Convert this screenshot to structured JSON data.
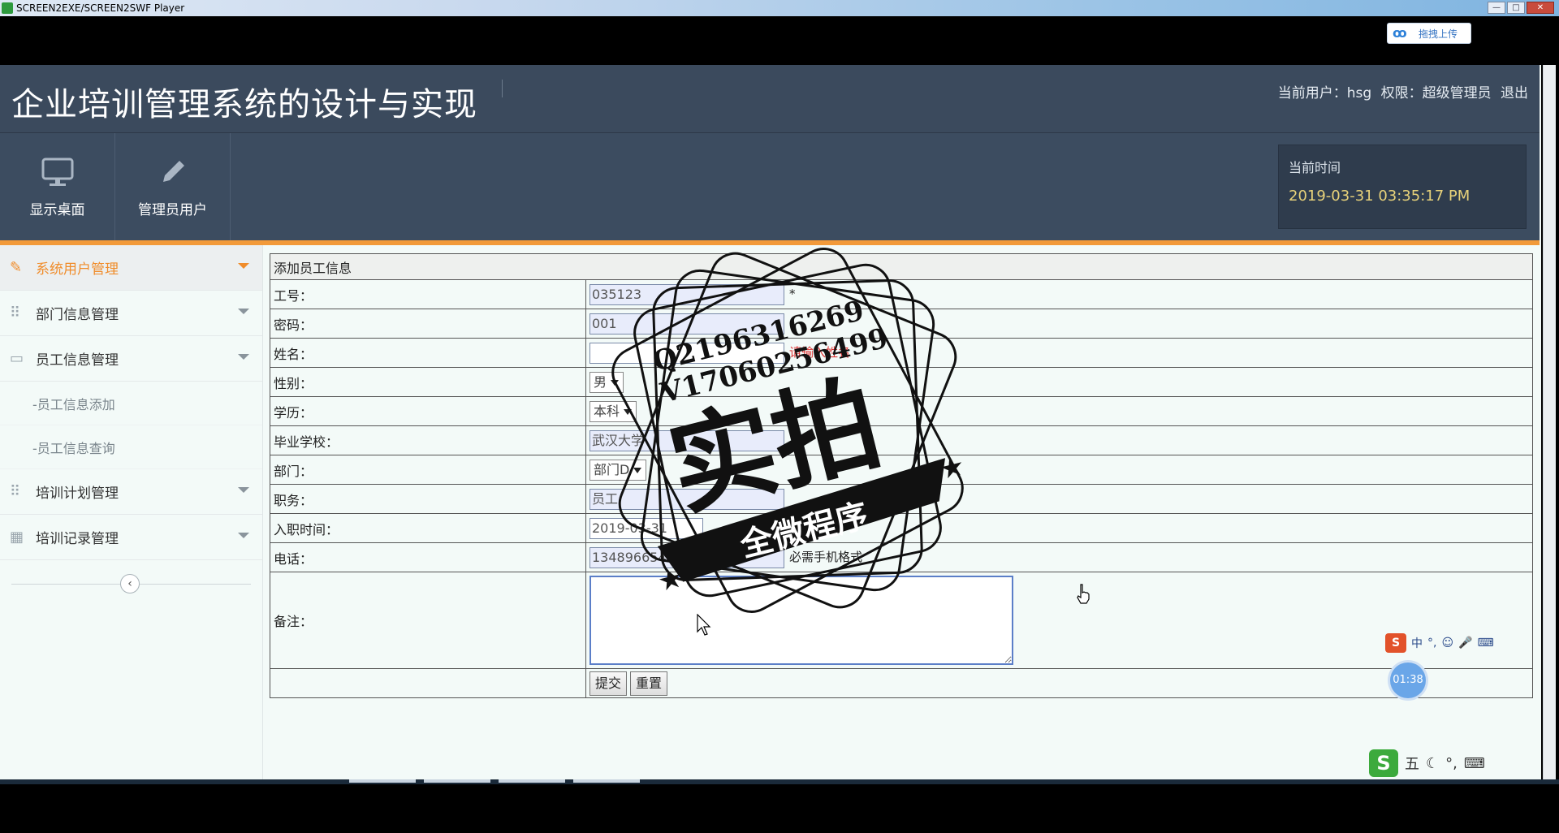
{
  "window": {
    "title": "SCREEN2EXE/SCREEN2SWF Player"
  },
  "upload_button": {
    "label": "拖拽上传"
  },
  "header": {
    "title": "企业培训管理系统的设计与实现",
    "user_label": "当前用户：hsg",
    "role_label": "权限：超级管理员",
    "logout": "退出"
  },
  "toolbar": {
    "buttons": [
      {
        "label": "显示桌面",
        "icon": "monitor-icon"
      },
      {
        "label": "管理员用户",
        "icon": "pencil-icon"
      }
    ],
    "time_label": "当前时间",
    "time_value": "2019-03-31 03:35:17 PM"
  },
  "sidebar": {
    "items": [
      {
        "label": "系统用户管理",
        "icon": "pencil-icon",
        "active": true
      },
      {
        "label": "部门信息管理",
        "icon": "grid-icon"
      },
      {
        "label": "员工信息管理",
        "icon": "monitor-icon"
      },
      {
        "label": "培训计划管理",
        "icon": "grid-icon"
      },
      {
        "label": "培训记录管理",
        "icon": "layout-icon"
      }
    ],
    "sub_items": [
      "-员工信息添加",
      "-员工信息查询"
    ]
  },
  "form": {
    "caption": "添加员工信息",
    "rows": {
      "emp_no": {
        "label": "工号：",
        "value": "035123",
        "mark": "*"
      },
      "password": {
        "label": "密码：",
        "value": "001"
      },
      "name": {
        "label": "姓名：",
        "value": "",
        "hint": "请输入姓名"
      },
      "gender": {
        "label": "性别：",
        "value": "男"
      },
      "education": {
        "label": "学历：",
        "value": "本科"
      },
      "school": {
        "label": "毕业学校：",
        "value": "武汉大学"
      },
      "dept": {
        "label": "部门：",
        "value": "部门D"
      },
      "position": {
        "label": "职务：",
        "value": "员工"
      },
      "join_date": {
        "label": "入职时间：",
        "value": "2019-03-31"
      },
      "phone": {
        "label": "电话：",
        "value": "13489665487",
        "hint": "必需手机格式"
      },
      "memo": {
        "label": "备注：",
        "value": ""
      }
    },
    "submit": "提交",
    "reset": "重置"
  },
  "watermark": {
    "line1": "Q2196316269",
    "line2": "V17060256499",
    "big": "实拍",
    "banner": "全微程序"
  },
  "tray": {
    "ime1": [
      "中",
      "°,",
      "☺",
      "🎤",
      "⌨"
    ],
    "timer": "01:38",
    "ime2": [
      "五",
      "☾",
      "°,",
      "⌨"
    ]
  }
}
